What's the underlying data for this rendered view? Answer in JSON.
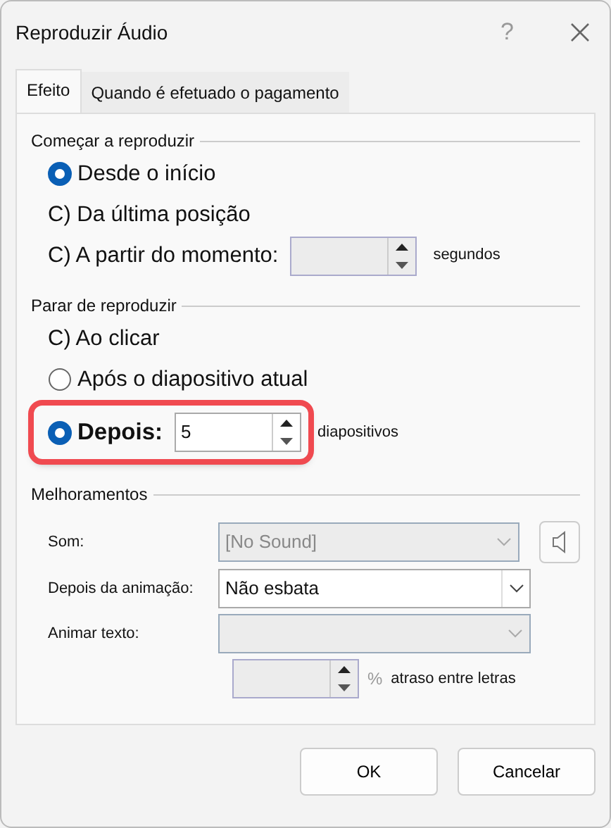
{
  "window": {
    "title": "Reproduzir Áudio",
    "help": "?"
  },
  "tabs": [
    {
      "label": "Efeito",
      "selected": true
    },
    {
      "label": "Quando é efetuado o pagamento",
      "selected": false
    }
  ],
  "sections": [
    {
      "label": "Começar a reproduzir",
      "options": [
        {
          "kind": "radio",
          "text": "Desde o início",
          "selected": true
        },
        {
          "kind": "plain",
          "text": "C) Da última posição"
        },
        {
          "kind": "plain",
          "text": "C) A partir do momento:",
          "spinner": {
            "disabled": true
          },
          "unit": "segundos"
        }
      ]
    },
    {
      "label": "Parar de reproduzir",
      "options": [
        {
          "kind": "plain",
          "text": "C) Ao clicar"
        },
        {
          "kind": "radio",
          "text": "Após o diapositivo atual",
          "selected": false
        },
        {
          "kind": "radio",
          "text": "Depois:",
          "selected": true,
          "highlighted": true,
          "spinner": {
            "value": "5",
            "disabled": false
          },
          "unit": "diapositivos"
        }
      ]
    }
  ],
  "enhancements": {
    "label": "Melhoramentos",
    "fields": [
      {
        "label": "Som:",
        "value": "[No Sound]",
        "disabled": true,
        "sound_button": true
      },
      {
        "label": "Depois da animação:",
        "value": "Não esbata",
        "disabled": false
      },
      {
        "label": "Animar texto:",
        "disabled": true
      }
    ],
    "delay": {
      "spinner": {
        "disabled": true
      },
      "unit": "%",
      "text": "atraso entre letras"
    }
  },
  "buttons": [
    "OK",
    "Cancelar"
  ]
}
